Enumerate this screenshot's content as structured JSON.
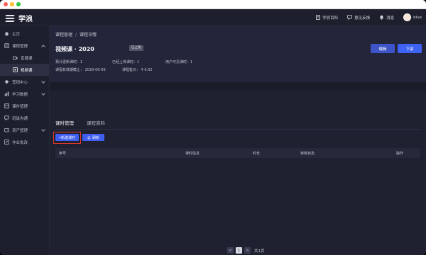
{
  "app": {
    "name": "学浪"
  },
  "topbar": {
    "actions": [
      {
        "label": "学浪百科",
        "icon": "doc-icon"
      },
      {
        "label": "意见反馈",
        "icon": "chat-icon"
      },
      {
        "label": "消息",
        "icon": "bell-icon"
      },
      {
        "label": "blue",
        "icon": "avatar"
      }
    ]
  },
  "sidebar": {
    "items": [
      {
        "label": "主页",
        "icon": "home-icon"
      },
      {
        "label": "课程管理",
        "icon": "book-icon"
      },
      {
        "label": "直播课",
        "icon": "video-icon"
      },
      {
        "label": "视频课",
        "icon": "play-icon"
      },
      {
        "label": "营销中心",
        "icon": "marketing-icon"
      },
      {
        "label": "学习数据",
        "icon": "chart-icon"
      },
      {
        "label": "课件管理",
        "icon": "folder-icon"
      },
      {
        "label": "班级沟通",
        "icon": "message-icon"
      },
      {
        "label": "资产管理",
        "icon": "wallet-icon"
      },
      {
        "label": "作业批改",
        "icon": "edit-icon"
      }
    ]
  },
  "breadcrumb": {
    "parent": "课程管理",
    "separator": "/",
    "current": "课程详情"
  },
  "course": {
    "title": "视频课 · 2020",
    "status": "已上架",
    "edit_label": "编辑",
    "offline_label": "下架",
    "info": {
      "planned": "预计更新课时：1",
      "uploaded": "已经上传课时：1",
      "visible": "用户可见课时：1",
      "validity": "课程有效期截止：  2020-09-06",
      "price": "课程售价：  ¥ 0.02"
    }
  },
  "tabs": [
    {
      "label": "课时管理"
    },
    {
      "label": "课程资料"
    }
  ],
  "actions": {
    "new_lesson": "+新建课时",
    "refresh": "刷新"
  },
  "table": {
    "columns": [
      "序号",
      "课时信息",
      "时长",
      "审核状态",
      "操作"
    ]
  },
  "pagination": {
    "prev": "<",
    "current": "1",
    "next": ">",
    "total": "共1页"
  }
}
